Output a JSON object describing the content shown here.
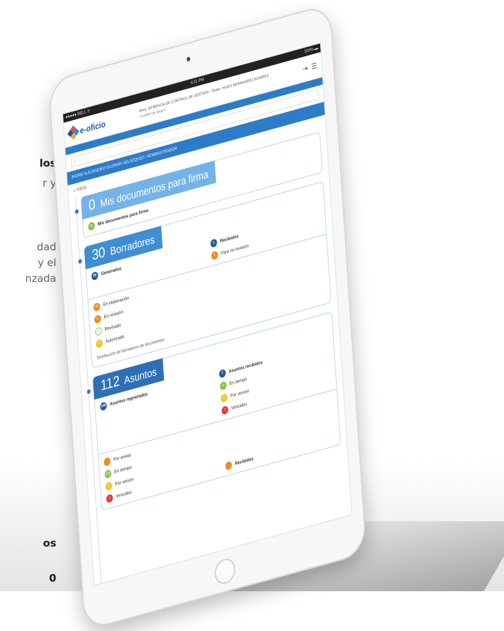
{
  "side_text": {
    "t1": "los",
    "t2": "r y",
    "t3": "dad",
    "t4": "y el",
    "t5": "nzada",
    "t6": "os",
    "t7": "0"
  },
  "status_bar": {
    "carrier": "●●●●● BELL ᯤ",
    "time": "4:21 PM",
    "battery": "100% ▬"
  },
  "app": {
    "logo_text": "e-oficio",
    "area_line": "Área: GERENCIA DE CONTROL DE GESTION - Titular: HUGO HERNANDEZ ALVAREZ",
    "area_sub": "Cambio de área ▾",
    "user_line": "JHONE ALEJANDRO GUZMÁN VELÁZQUEZ / ADMINISTRADOR",
    "breadcrumb": "Inicio"
  },
  "cards": {
    "firma": {
      "count": "0",
      "title": "Mis documentos para firma",
      "item_count": "0",
      "item_label": "Mis documentos para firma"
    },
    "borradores": {
      "count": "30",
      "title": "Borradores",
      "generados_count": "29",
      "generados_label": "Generados",
      "recibidos_count": "1",
      "recibidos_label": "Recibidos",
      "para_revision_count": "1",
      "para_revision_label": "Para mi revisión",
      "items": [
        {
          "count": "15",
          "label": "En elaboración"
        },
        {
          "count": "5",
          "label": "En revisión"
        },
        {
          "count": "4",
          "label": "Revisado"
        },
        {
          "count": "5",
          "label": "Autorizado"
        }
      ],
      "caption": "Distribución de borradores de documentos"
    },
    "asuntos": {
      "count": "112",
      "title": "Asuntos",
      "registrados_count": "105",
      "registrados_label": "Asuntos registrados",
      "recibidos_count": "7",
      "recibidos_label": "Asuntos recibidos",
      "left_items": [
        {
          "count": "",
          "label": "Por enviar"
        },
        {
          "count": "104",
          "label": "En tiempo"
        },
        {
          "count": "1",
          "label": "Por vencer"
        },
        {
          "count": "1",
          "label": "Vencidos"
        }
      ],
      "right_items": [
        {
          "count": "4",
          "label": "En tiempo"
        },
        {
          "count": "2",
          "label": "Por vencer"
        },
        {
          "count": "1",
          "label": "Vencidos"
        }
      ],
      "footer_label": "Recibidos"
    }
  },
  "colors": {
    "brand": "#2d7cc8",
    "green": "#8bc34a",
    "orange": "#f08a24",
    "yellow": "#f3c623",
    "red": "#e53935"
  }
}
